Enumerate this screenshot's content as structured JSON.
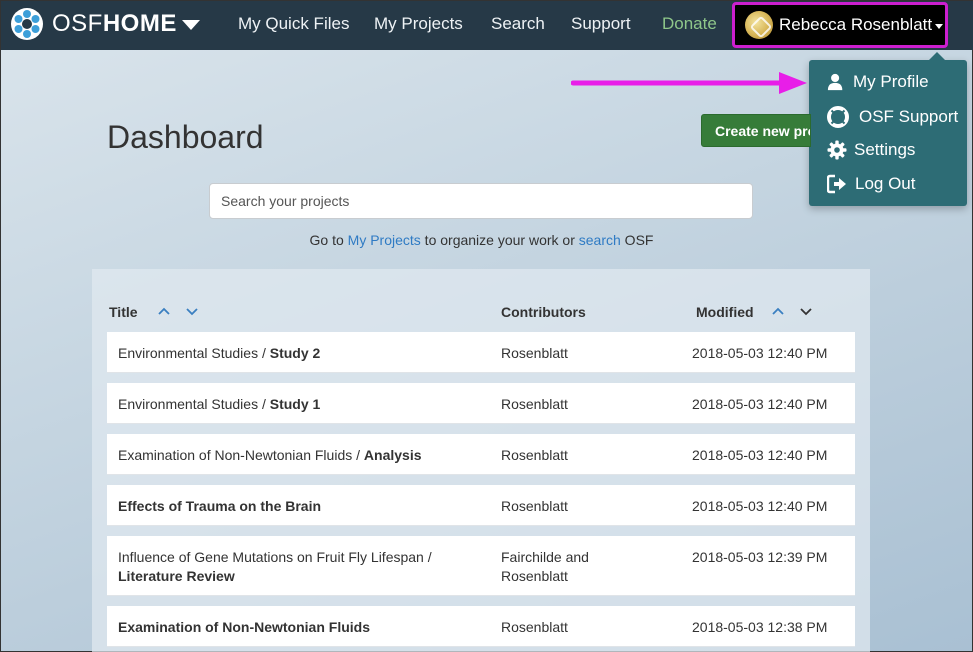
{
  "brand": {
    "name_thin": "OSF",
    "name_bold": "HOME"
  },
  "nav": {
    "quick_files": "My Quick Files",
    "my_projects": "My Projects",
    "search": "Search",
    "support": "Support",
    "donate": "Donate",
    "user_name": "Rebecca Rosenblatt"
  },
  "dropdown": {
    "items": [
      {
        "label": "My Profile",
        "icon": "user-icon"
      },
      {
        "label": "OSF Support",
        "icon": "lifebuoy-icon"
      },
      {
        "label": "Settings",
        "icon": "gear-icon"
      },
      {
        "label": "Log Out",
        "icon": "logout-icon"
      }
    ]
  },
  "main": {
    "title": "Dashboard",
    "create_button": "Create new project",
    "search_placeholder": "Search your projects",
    "helper": {
      "pre": "Go to ",
      "link1": "My Projects",
      "mid": " to organize your work or ",
      "link2": "search",
      "post": " OSF"
    }
  },
  "table": {
    "headers": {
      "title": "Title",
      "contributors": "Contributors",
      "modified": "Modified"
    },
    "rows": [
      {
        "parent": "Environmental Studies / ",
        "name": "Study 2",
        "contributors": "Rosenblatt",
        "modified": "2018-05-03 12:40 PM"
      },
      {
        "parent": "Environmental Studies / ",
        "name": "Study 1",
        "contributors": "Rosenblatt",
        "modified": "2018-05-03 12:40 PM"
      },
      {
        "parent": "Examination of Non-Newtonian Fluids / ",
        "name": "Analysis",
        "contributors": "Rosenblatt",
        "modified": "2018-05-03 12:40 PM"
      },
      {
        "parent": "",
        "name": "Effects of Trauma on the Brain",
        "contributors": "Rosenblatt",
        "modified": "2018-05-03 12:40 PM"
      },
      {
        "parent": "Influence of Gene Mutations on Fruit Fly Lifespan /",
        "name": "Literature Review",
        "contributors_line1": "Fairchilde and",
        "contributors_line2": "Rosenblatt",
        "modified": "2018-05-03 12:39 PM"
      },
      {
        "parent": "",
        "name": "Examination of Non-Newtonian Fluids",
        "contributors": "Rosenblatt",
        "modified": "2018-05-03 12:38 PM"
      }
    ]
  },
  "colors": {
    "navbar": "#263947",
    "dropdown": "#2d6c75",
    "highlight": "#cc1fcf",
    "create": "#367c39",
    "link": "#2f7bc4"
  }
}
